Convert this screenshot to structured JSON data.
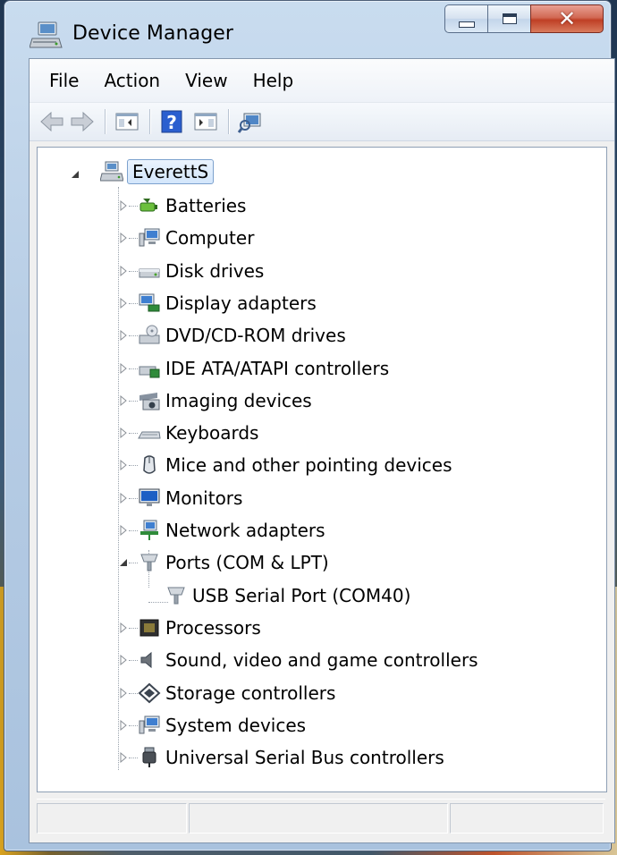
{
  "window": {
    "title": "Device Manager"
  },
  "menu": [
    "File",
    "Action",
    "View",
    "Help"
  ],
  "toolbar_icons": [
    "back-arrow-icon",
    "forward-arrow-icon",
    "show-hide-console-tree-icon",
    "help-icon",
    "properties-pane-icon",
    "scan-hardware-icon"
  ],
  "tree": {
    "root": {
      "label": "EverettS",
      "expanded": true,
      "icon": "computer-icon"
    },
    "categories": [
      {
        "label": "Batteries",
        "icon": "battery-icon",
        "expanded": false
      },
      {
        "label": "Computer",
        "icon": "computer-icon",
        "expanded": false
      },
      {
        "label": "Disk drives",
        "icon": "disk-drive-icon",
        "expanded": false
      },
      {
        "label": "Display adapters",
        "icon": "display-adapter-icon",
        "expanded": false
      },
      {
        "label": "DVD/CD-ROM drives",
        "icon": "dvd-drive-icon",
        "expanded": false
      },
      {
        "label": "IDE ATA/ATAPI controllers",
        "icon": "ide-controller-icon",
        "expanded": false
      },
      {
        "label": "Imaging devices",
        "icon": "camera-icon",
        "expanded": false
      },
      {
        "label": "Keyboards",
        "icon": "keyboard-icon",
        "expanded": false
      },
      {
        "label": "Mice and other pointing devices",
        "icon": "mouse-icon",
        "expanded": false
      },
      {
        "label": "Monitors",
        "icon": "monitor-icon",
        "expanded": false
      },
      {
        "label": "Network adapters",
        "icon": "network-adapter-icon",
        "expanded": false
      },
      {
        "label": "Ports (COM & LPT)",
        "icon": "port-icon",
        "expanded": true,
        "children": [
          {
            "label": "USB Serial Port (COM40)",
            "icon": "port-icon"
          }
        ]
      },
      {
        "label": "Processors",
        "icon": "processor-icon",
        "expanded": false
      },
      {
        "label": "Sound, video and game controllers",
        "icon": "speaker-icon",
        "expanded": false
      },
      {
        "label": "Storage controllers",
        "icon": "storage-controller-icon",
        "expanded": false
      },
      {
        "label": "System devices",
        "icon": "system-device-icon",
        "expanded": false
      },
      {
        "label": "Universal Serial Bus controllers",
        "icon": "usb-icon",
        "expanded": false
      }
    ]
  },
  "colors": {
    "selection_border": "#7da2ce",
    "close_button": "#c8452c"
  }
}
